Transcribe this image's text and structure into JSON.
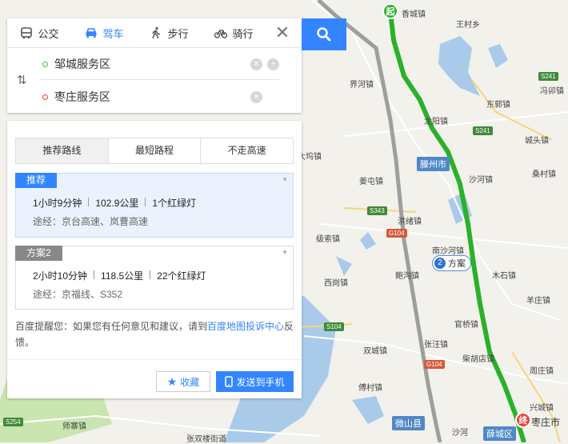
{
  "map": {
    "towns": [
      {
        "name": "香城镇"
      },
      {
        "name": "王村乡"
      },
      {
        "name": "界河镇"
      },
      {
        "name": "冯卯镇"
      },
      {
        "name": "东郭镇"
      },
      {
        "name": "龙阳镇"
      },
      {
        "name": "城头镇"
      },
      {
        "name": "大坞镇"
      },
      {
        "name": "桑村镇"
      },
      {
        "name": "沙河镇"
      },
      {
        "name": "姜屯镇"
      },
      {
        "name": "洪绪镇"
      },
      {
        "name": "南沙河镇"
      },
      {
        "name": "级索镇"
      },
      {
        "name": "鲍沟镇"
      },
      {
        "name": "木石镇"
      },
      {
        "name": "西岗镇"
      },
      {
        "name": "羊庄镇"
      },
      {
        "name": "官桥镇"
      },
      {
        "name": "双城镇"
      },
      {
        "name": "张汪镇"
      },
      {
        "name": "柴胡店镇"
      },
      {
        "name": "周庄镇"
      },
      {
        "name": "傅村镇"
      },
      {
        "name": "兴城镇"
      },
      {
        "name": "师寨镇"
      },
      {
        "name": "张双楼街道"
      },
      {
        "name": "沙河"
      }
    ],
    "cities": [
      {
        "name": "滕州市"
      },
      {
        "name": "微山县"
      },
      {
        "name": "薛城区"
      },
      {
        "name": "枣庄市"
      }
    ],
    "shields": [
      {
        "code": "S241"
      },
      {
        "code": "S241"
      },
      {
        "code": "S343"
      },
      {
        "code": "G104"
      },
      {
        "code": "S104"
      },
      {
        "code": "G104"
      },
      {
        "code": "S254"
      }
    ],
    "start_marker": "起",
    "end_marker": "终",
    "alt_route_bubble": {
      "num": "2",
      "label": "方案"
    },
    "colors": {
      "route": "#2ab12a",
      "alt_route": "#9e9e9e",
      "water": "#a9cbe9",
      "green_area": "#c9e5b0"
    }
  },
  "panel": {
    "modes": [
      {
        "label": "公交",
        "icon": "bus-icon"
      },
      {
        "label": "驾车",
        "icon": "car-icon",
        "active": true
      },
      {
        "label": "步行",
        "icon": "walk-icon"
      },
      {
        "label": "骑行",
        "icon": "bike-icon"
      }
    ],
    "close_icon": "✕",
    "origin": "邹城服务区",
    "destination": "枣庄服务区",
    "route_tabs": [
      "推荐路线",
      "最短路程",
      "不走高速"
    ],
    "routes": [
      {
        "tag": "推荐",
        "duration": "1小时9分钟",
        "distance": "102.9公里",
        "lights": "1个红绿灯",
        "via": "途经：京台高速、岚曹高速",
        "tag_color": "#3385ff"
      },
      {
        "tag": "方案2",
        "duration": "2小时10分钟",
        "distance": "118.5公里",
        "lights": "22个红绿灯",
        "via": "途经：京福线、S352",
        "tag_color": "#888888"
      }
    ],
    "tip_prefix": "百度提醒您：如果您有任何意见和建议，请到",
    "tip_link": "百度地图投诉中心",
    "tip_suffix": "反馈。",
    "fav_label": "收藏",
    "send_label": "发送到手机"
  }
}
